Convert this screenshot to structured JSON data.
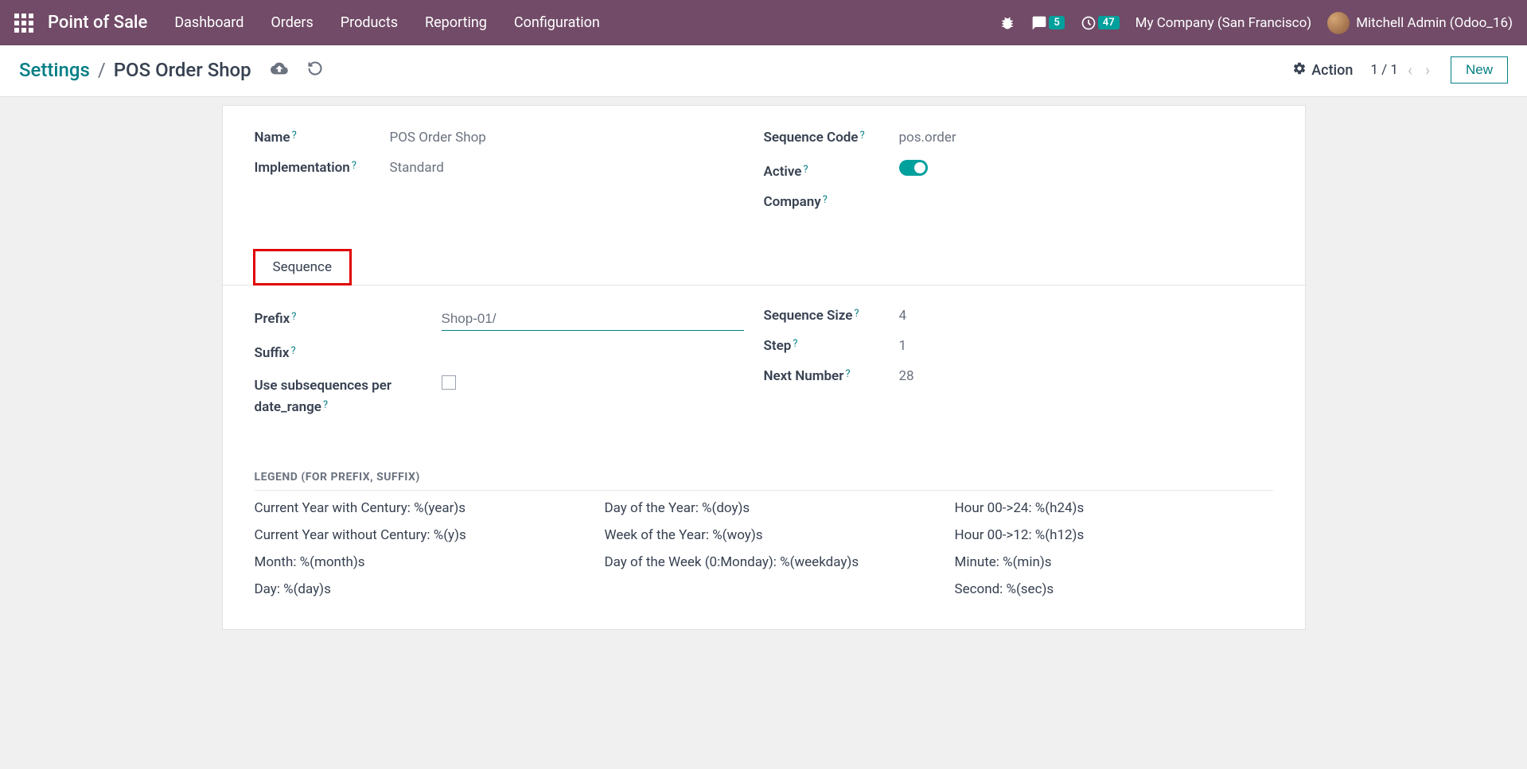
{
  "navbar": {
    "brand": "Point of Sale",
    "menu": [
      "Dashboard",
      "Orders",
      "Products",
      "Reporting",
      "Configuration"
    ],
    "messages_badge": "5",
    "activity_badge": "47",
    "company": "My Company (San Francisco)",
    "user": "Mitchell Admin (Odoo_16)"
  },
  "breadcrumb": {
    "parent": "Settings",
    "current": "POS Order Shop"
  },
  "control": {
    "action_label": "Action",
    "pager": "1 / 1",
    "new_label": "New"
  },
  "form": {
    "name_label": "Name",
    "name_value": "POS Order Shop",
    "impl_label": "Implementation",
    "impl_value": "Standard",
    "code_label": "Sequence Code",
    "code_value": "pos.order",
    "active_label": "Active",
    "company_label": "Company"
  },
  "tabs": {
    "sequence": "Sequence"
  },
  "sequence": {
    "prefix_label": "Prefix",
    "prefix_value": "Shop-01/",
    "suffix_label": "Suffix",
    "subseq_label": "Use subsequences per date_range",
    "size_label": "Sequence Size",
    "size_value": "4",
    "step_label": "Step",
    "step_value": "1",
    "next_label": "Next Number",
    "next_value": "28"
  },
  "legend": {
    "title": "LEGEND (FOR PREFIX, SUFFIX)",
    "items": [
      "Current Year with Century: %(year)s",
      "Day of the Year: %(doy)s",
      "Hour 00->24: %(h24)s",
      "Current Year without Century: %(y)s",
      "Week of the Year: %(woy)s",
      "Hour 00->12: %(h12)s",
      "Month: %(month)s",
      "Day of the Week (0:Monday): %(weekday)s",
      "Minute: %(min)s",
      "Day: %(day)s",
      "",
      "Second: %(sec)s"
    ]
  }
}
